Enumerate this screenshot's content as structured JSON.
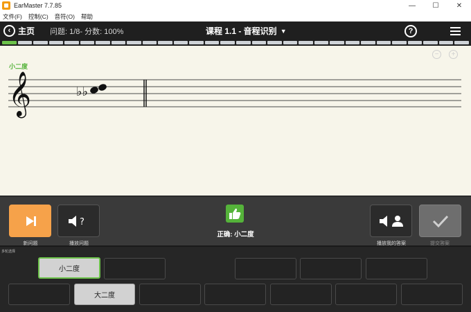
{
  "window": {
    "title": "EarMaster 7.7.85",
    "controls": [
      "—",
      "☐",
      "✕"
    ]
  },
  "menubar": {
    "items": [
      "文件(F)",
      "控制(C)",
      "音符(O)",
      "帮助"
    ]
  },
  "topnav": {
    "home_label": "主页",
    "stats": "问题: 1/8- 分数: 100%",
    "lesson_title": "课程 1.1 - 音程识别",
    "help_icon": "question-circle-icon",
    "menu_icon": "hamburger-menu-icon"
  },
  "progress": {
    "total_segments": 30,
    "completed_segments": 1
  },
  "staff": {
    "interval_label": "小二度",
    "clef": "treble-clef",
    "notes": [
      "C",
      "D♭♭"
    ],
    "accidental": "double-flat"
  },
  "controls": {
    "new_question_label": "新问题",
    "play_question_label": "播放问题",
    "result_text": "正确: 小二度",
    "play_answer_label": "播放我的答案",
    "submit_label": "提交答案"
  },
  "answers": {
    "title": "多轮选择",
    "row1": [
      "小二度",
      "",
      "",
      "",
      ""
    ],
    "row2": [
      "",
      "大二度",
      "",
      "",
      "",
      "",
      "",
      ""
    ]
  },
  "colors": {
    "accent_green": "#6cc24a",
    "orange": "#f6a24a",
    "dark_bg": "#1f1f1f",
    "staff_bg": "#f7f5ea"
  }
}
